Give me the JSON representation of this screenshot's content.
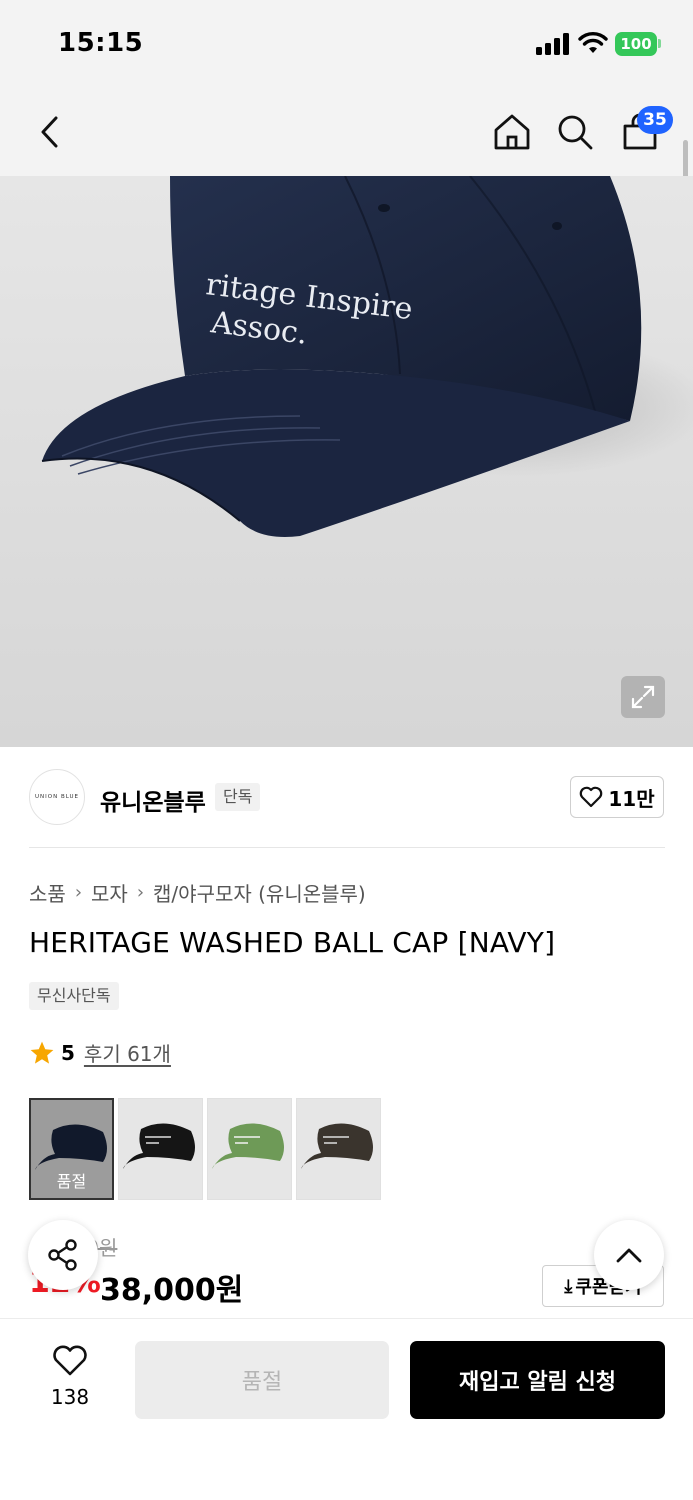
{
  "status_bar": {
    "time": "15:15",
    "battery": "100"
  },
  "header": {
    "cart_count": "35"
  },
  "brand": {
    "logo_text": "UNION BLUE",
    "name": "유니온블루",
    "tag": "단독",
    "likes": "11만"
  },
  "breadcrumb": [
    "소품",
    "모자",
    "캡/야구모자 (유니온블루)"
  ],
  "product": {
    "title": "HERITAGE WASHED BALL CAP [NAVY]",
    "exclusive_tag": "무신사단독",
    "rating": "5",
    "review_link": "후기 61개",
    "cap_text_line1": "ritage Inspire",
    "cap_text_line2": "Assoc."
  },
  "swatches": [
    {
      "name": "navy",
      "color": "#1a2540",
      "sold_out_label": "품절"
    },
    {
      "name": "black",
      "color": "#151515"
    },
    {
      "name": "green",
      "color": "#6e9a57"
    },
    {
      "name": "brown",
      "color": "#3a342d"
    }
  ],
  "price": {
    "original": "43,000원",
    "discount": "12%",
    "sale": "38,000원",
    "coupon_label": "쿠폰받기"
  },
  "bottom_bar": {
    "wish_count": "138",
    "sold_out_label": "품절",
    "restock_label": "재입고 알림 신청"
  },
  "colors": {
    "accent_red": "#ee1b24",
    "badge_blue": "#1f63ff",
    "navy_cap": "#1a2540"
  }
}
